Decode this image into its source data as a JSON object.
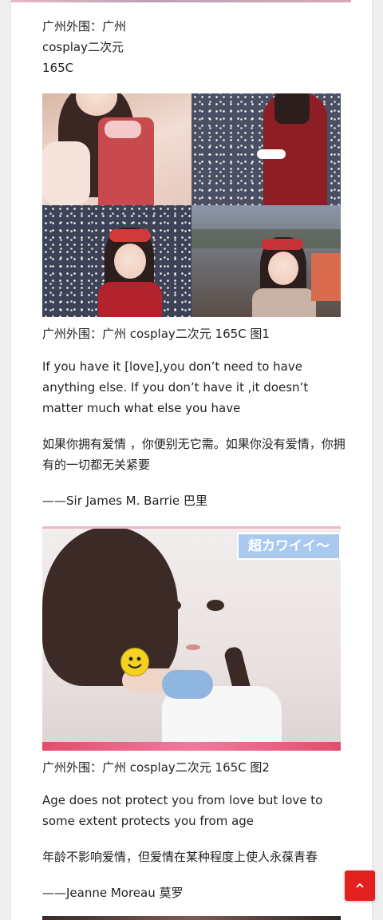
{
  "post": {
    "meta_line1": "广州外围：广州",
    "meta_line2": "cosplay二次元",
    "meta_line3": "165C",
    "caption1": "广州外围：广州 cosplay二次元 165C 图1",
    "quote1_en": "If you have it [love],you don’t need to have anything else. If you don’t have it ,it doesn’t matter much what else you have",
    "quote1_zh": "如果你拥有爱情 ，你便别无它需。如果你没有爱情，你拥有的一切都无关紧要",
    "quote1_author": "——Sir James M. Barrie 巴里",
    "image2_badge": "超カワイイ～",
    "caption2": "广州外围：广州 cosplay二次元 165C 图2",
    "quote2_en": "Age does not protect you from love but love to some extent protects you from age",
    "quote2_zh": "年龄不影响爱情，但爱情在某种程度上使人永葆青春",
    "quote2_author": "——Jeanne Moreau 莫罗"
  },
  "icons": {
    "scroll_top": "chevron-up-icon",
    "sticker": "smiley-icon"
  },
  "colors": {
    "scroll_button": "#e1201f",
    "badge_bg": "#a9c9ef"
  }
}
